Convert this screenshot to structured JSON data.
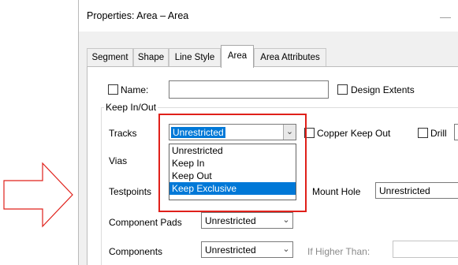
{
  "dialog": {
    "title": "Properties: Area – Area",
    "minimize_glyph": "—"
  },
  "tabs": [
    {
      "label": "Segment"
    },
    {
      "label": "Shape"
    },
    {
      "label": "Line Style"
    },
    {
      "label": "Area",
      "active": true
    },
    {
      "label": "Area Attributes"
    }
  ],
  "name_row": {
    "name_label": "Name:",
    "name_value": "",
    "design_extents_label": "Design Extents"
  },
  "keep_in_out": {
    "title": "Keep In/Out",
    "tracks": {
      "label": "Tracks",
      "value": "Unrestricted",
      "copper_keep_out_label": "Copper  Keep Out",
      "drill_label": "Drill"
    },
    "vias": {
      "label": "Vias"
    },
    "testpoints": {
      "label": "Testpoints",
      "mount_hole_label": "Mount Hole",
      "mount_hole_value": "Unrestricted"
    },
    "component_pads": {
      "label": "Component Pads",
      "value": "Unrestricted"
    },
    "components": {
      "label": "Components",
      "value": "Unrestricted",
      "if_higher_than_label": "If Higher Than:"
    }
  },
  "dropdown": {
    "options": [
      "Unrestricted",
      "Keep In",
      "Keep Out",
      "Keep Exclusive"
    ],
    "highlighted": "Keep Exclusive"
  },
  "annotation": {
    "arrow_color": "#e0201a",
    "box_color": "#e0201a"
  },
  "icons": {
    "chevron": "chevron-down-icon",
    "arrow": "right-arrow-icon"
  },
  "colors": {
    "selection": "#0078d7",
    "annotation": "#e0201a"
  }
}
